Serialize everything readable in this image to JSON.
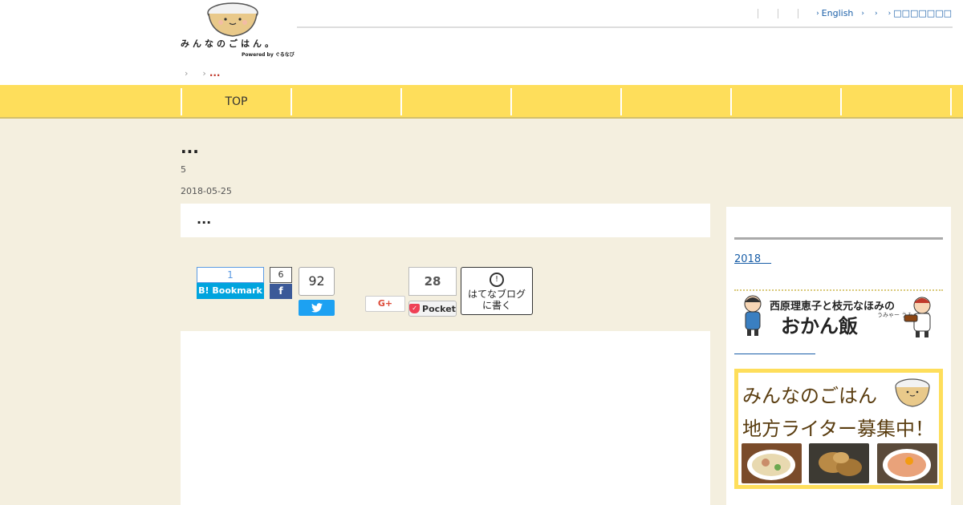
{
  "header": {
    "logo_text": "みんなのごはん。",
    "logo_powered": "Powered by ぐるなび",
    "links": [
      {
        "label": "English"
      },
      {
        "label": ""
      },
      {
        "label": ""
      },
      {
        "label": "□□□□□□□"
      }
    ]
  },
  "breadcrumb": {
    "current": "..."
  },
  "nav": {
    "items": [
      {
        "label": "TOP"
      },
      {
        "label": ""
      },
      {
        "label": ""
      },
      {
        "label": ""
      },
      {
        "label": ""
      },
      {
        "label": ""
      },
      {
        "label": ""
      }
    ]
  },
  "article": {
    "title": "...",
    "count": "5",
    "date": "2018-05-25",
    "lead": "..."
  },
  "share": {
    "hatena_count": "1",
    "hatena_label": "B! Bookmark",
    "facebook_count": "6",
    "twitter_count": "92",
    "gplus_label": "G+",
    "pocket_count": "28",
    "pocket_label": "Pocket",
    "hatena_blog_line1": "はてなブログ",
    "hatena_blog_line2": "に書く"
  },
  "sidebar": {
    "archive_link": "2018　",
    "banner1_title": "西原理恵子と枝元なほみの",
    "banner1_big": "おかん飯",
    "banner1_note": "うみゃー うみゃー編",
    "banner2_line1": "みんなのごはん",
    "banner2_line2": "地方ライター募集中！"
  },
  "colors": {
    "nav_yellow": "#fede5b",
    "page_bg": "#f4efdf",
    "link_blue": "#1a5fa8",
    "breadcrumb_red": "#c0392b"
  }
}
